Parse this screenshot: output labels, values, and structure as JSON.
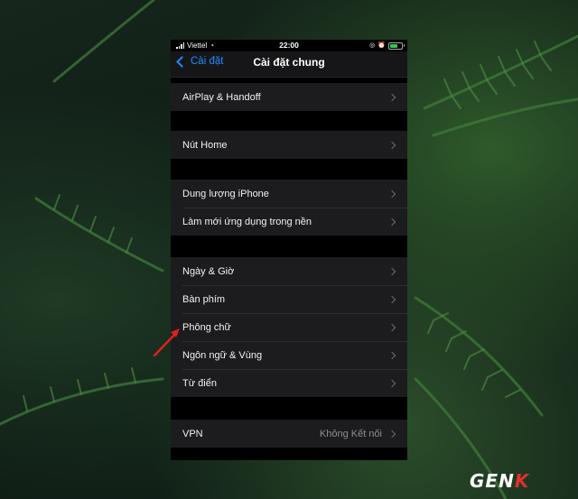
{
  "status_bar": {
    "carrier": "Viettel",
    "time": "22:00"
  },
  "nav": {
    "back_label": "Cài đặt",
    "title": "Cài đặt chung"
  },
  "groups": [
    {
      "items": [
        {
          "label": "AirPlay & Handoff"
        }
      ]
    },
    {
      "items": [
        {
          "label": "Nút Home"
        }
      ]
    },
    {
      "items": [
        {
          "label": "Dung lượng iPhone"
        },
        {
          "label": "Làm mới ứng dụng trong nền"
        }
      ]
    },
    {
      "items": [
        {
          "label": "Ngày & Giờ"
        },
        {
          "label": "Bàn phím"
        },
        {
          "label": "Phông chữ"
        },
        {
          "label": "Ngôn ngữ & Vùng"
        },
        {
          "label": "Từ điển"
        }
      ]
    },
    {
      "items": [
        {
          "label": "VPN",
          "value": "Không Kết nối"
        }
      ]
    }
  ],
  "colors": {
    "accent": "#1e8bff",
    "annotation_arrow": "#e02020",
    "battery": "#35c759"
  },
  "watermark": {
    "brand_main": "GEN",
    "brand_accent": "K"
  }
}
